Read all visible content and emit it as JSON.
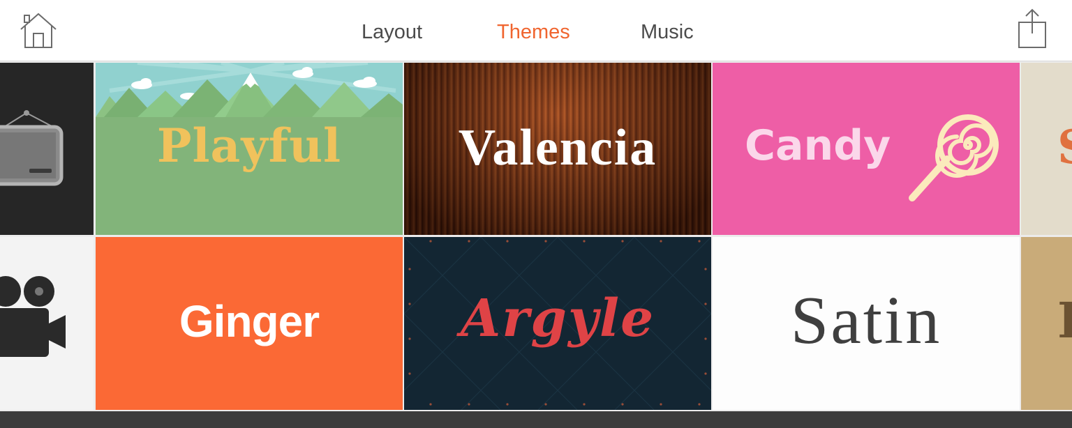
{
  "topbar": {
    "home_icon": "home-icon",
    "share_icon": "share-icon",
    "tabs": [
      {
        "label": "Layout",
        "active": false
      },
      {
        "label": "Themes",
        "active": true
      },
      {
        "label": "Music",
        "active": false
      }
    ]
  },
  "colors": {
    "accent": "#f0652f",
    "tab_text": "#4b4b4b",
    "bottom_bar": "#3c3c3c"
  },
  "themes": {
    "row1": [
      {
        "label": "",
        "icon": "picture-frame-icon"
      },
      {
        "label": "Playful"
      },
      {
        "label": "Valencia"
      },
      {
        "label": "Candy",
        "icon": "lollipop-icon"
      },
      {
        "label": "S"
      }
    ],
    "row2": [
      {
        "label": "",
        "icon": "film-camera-icon"
      },
      {
        "label": "Ginger"
      },
      {
        "label": "Argyle"
      },
      {
        "label": "Satin"
      },
      {
        "label": "I"
      }
    ]
  }
}
